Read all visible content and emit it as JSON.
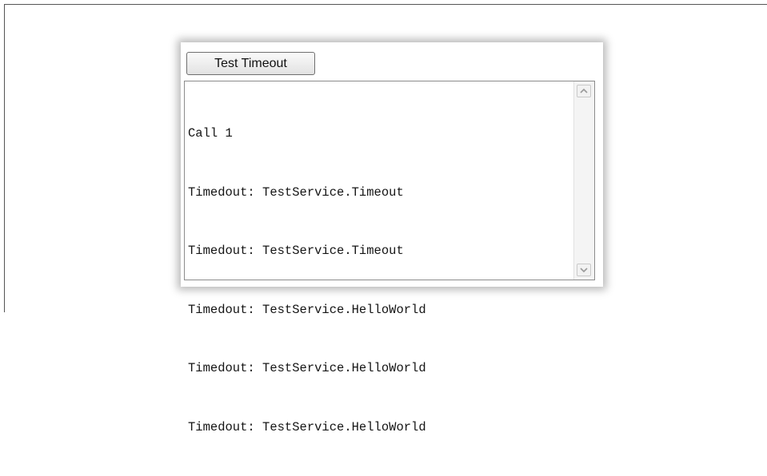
{
  "toolbar": {
    "test_timeout_label": "Test Timeout"
  },
  "output": {
    "lines": [
      "Call 1",
      "Timedout: TestService.Timeout",
      "Timedout: TestService.Timeout",
      "Timedout: TestService.HelloWorld",
      "Timedout: TestService.HelloWorld",
      "Timedout: TestService.HelloWorld"
    ]
  },
  "scrollbar": {
    "up_icon": "chevron-up-icon",
    "down_icon": "chevron-down-icon"
  }
}
